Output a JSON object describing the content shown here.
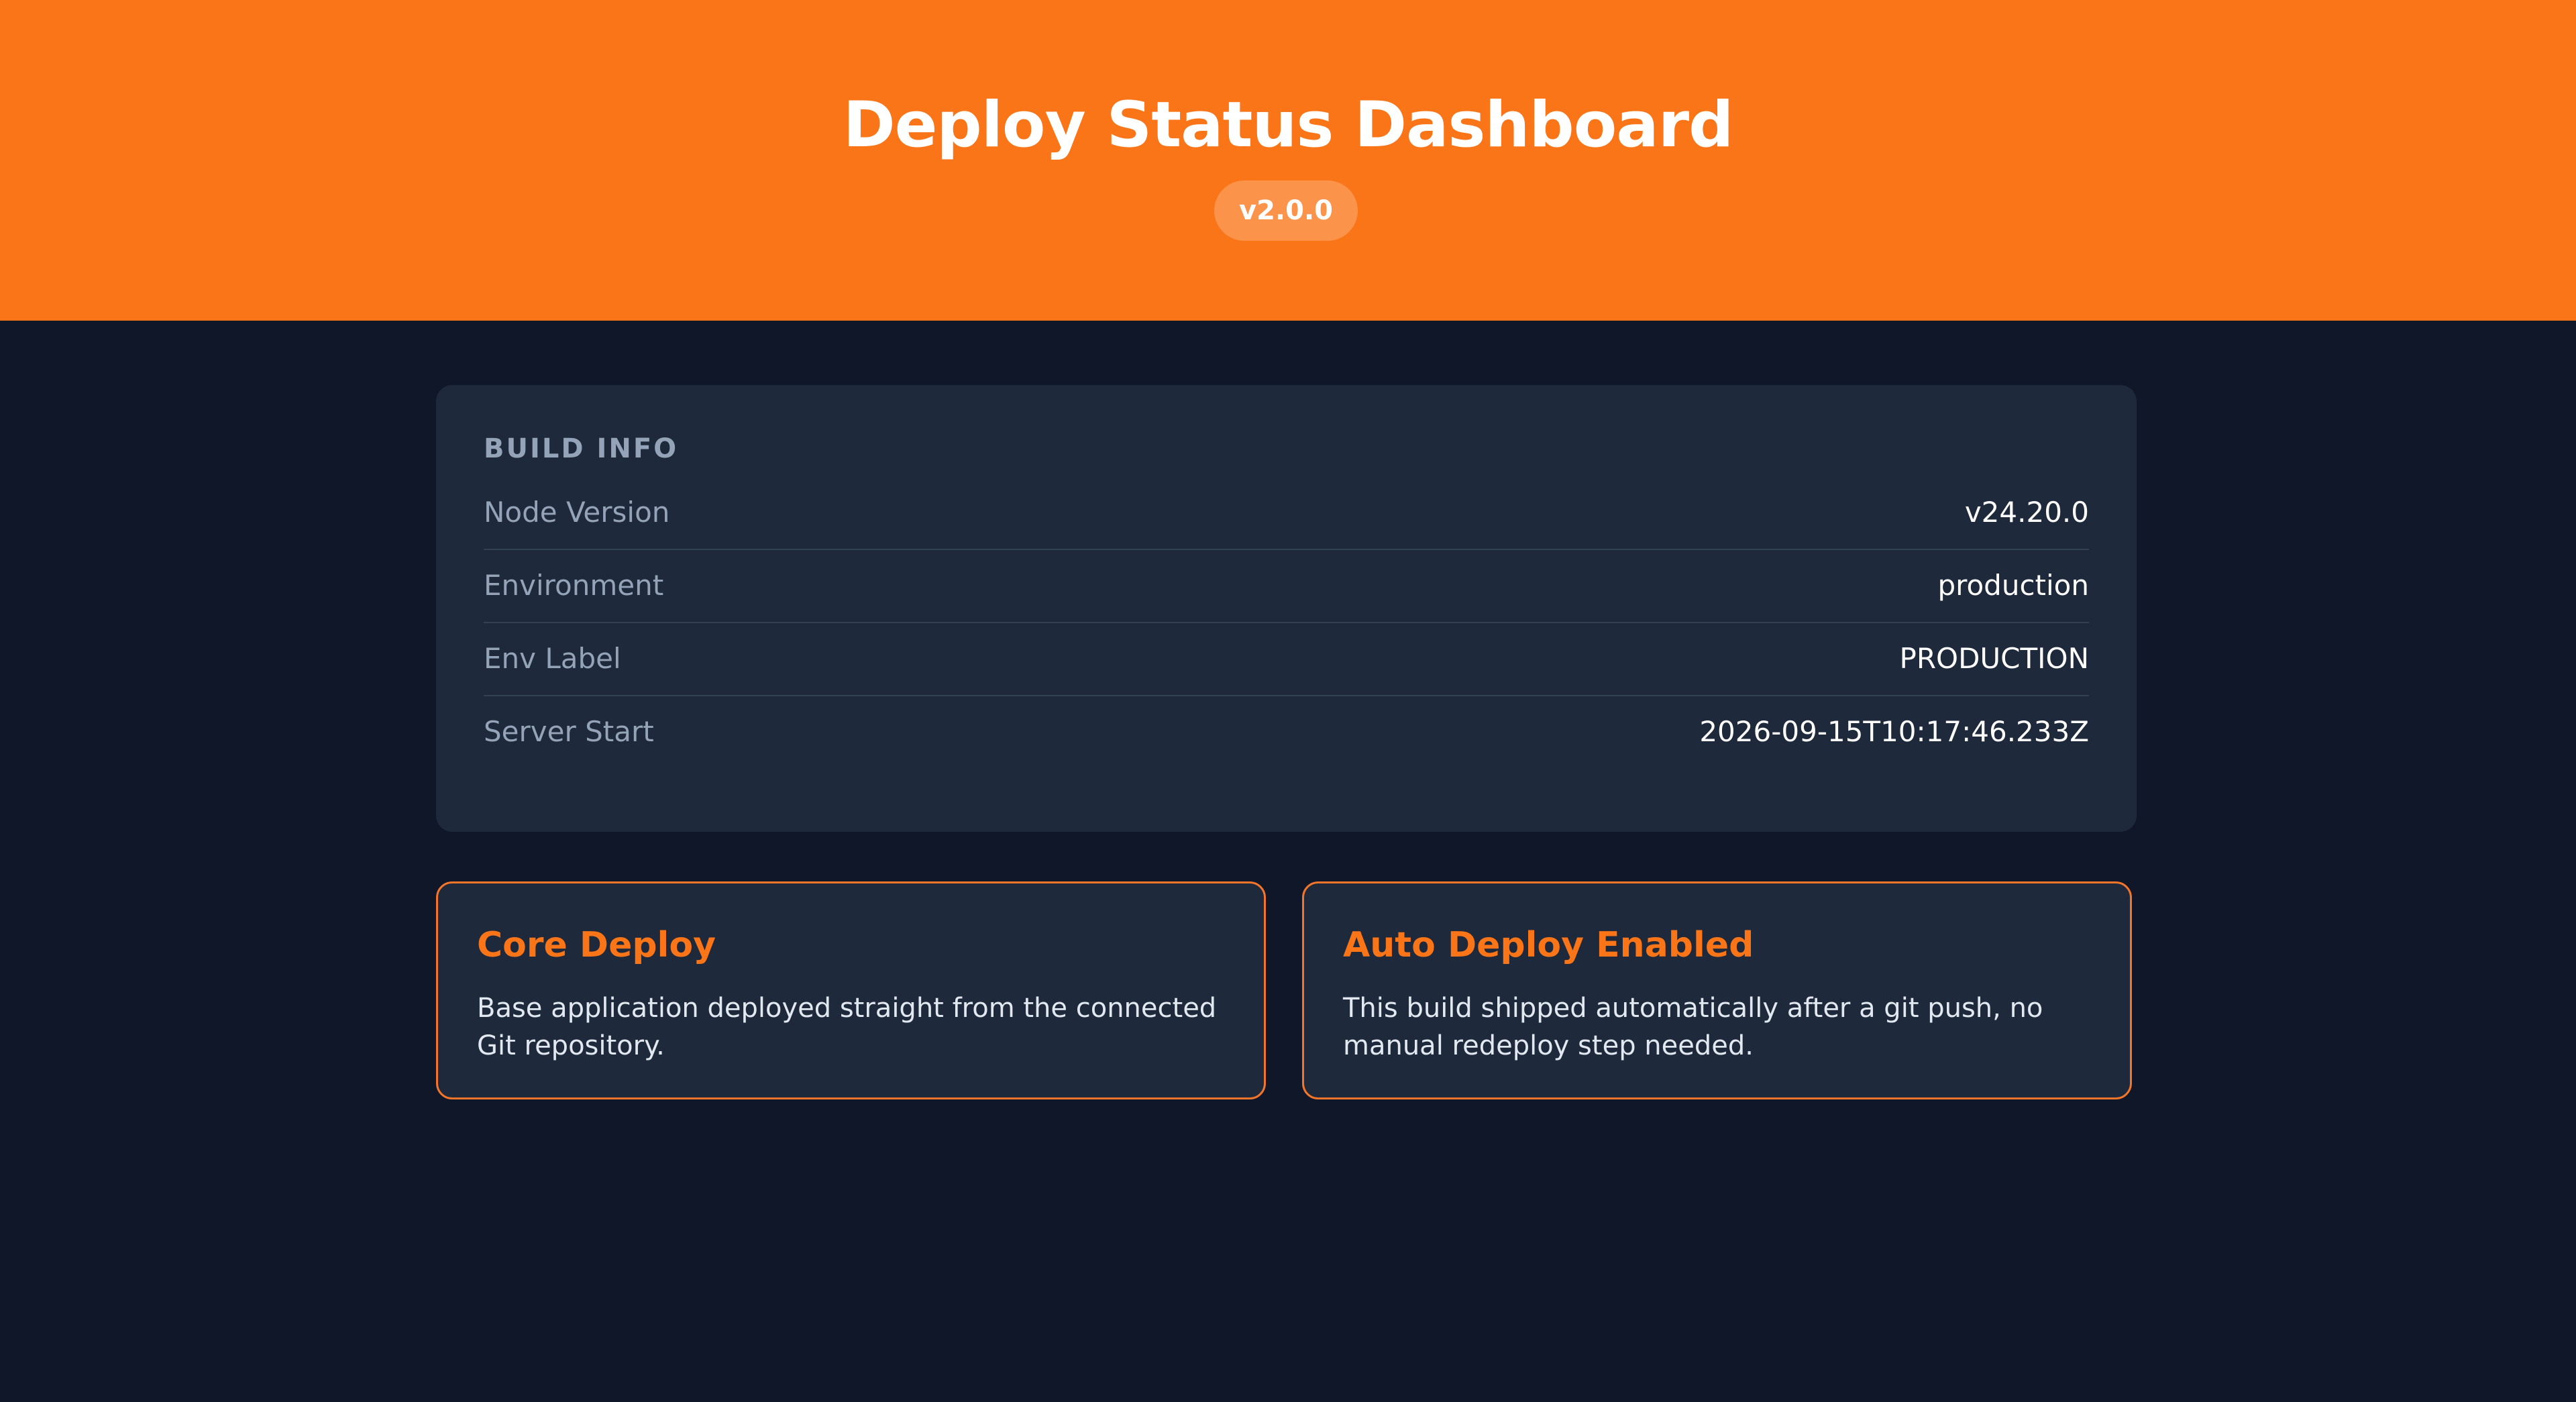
{
  "header": {
    "title": "Deploy Status Dashboard",
    "version": "v2.0.0"
  },
  "build_info": {
    "section_title": "BUILD INFO",
    "rows": [
      {
        "label": "Node Version",
        "value": "v24.20.0"
      },
      {
        "label": "Environment",
        "value": "production"
      },
      {
        "label": "Env Label",
        "value": "PRODUCTION"
      },
      {
        "label": "Server Start",
        "value": "2026-09-15T10:17:46.233Z"
      }
    ]
  },
  "features": [
    {
      "title": "Core Deploy",
      "description": "Base application deployed straight from the connected Git repository."
    },
    {
      "title": "Auto Deploy Enabled",
      "description": "This build shipped automatically after a git push, no manual redeploy step needed."
    }
  ],
  "colors": {
    "accent": "#fa7518",
    "background": "#0f1729",
    "card": "#1e293b"
  }
}
